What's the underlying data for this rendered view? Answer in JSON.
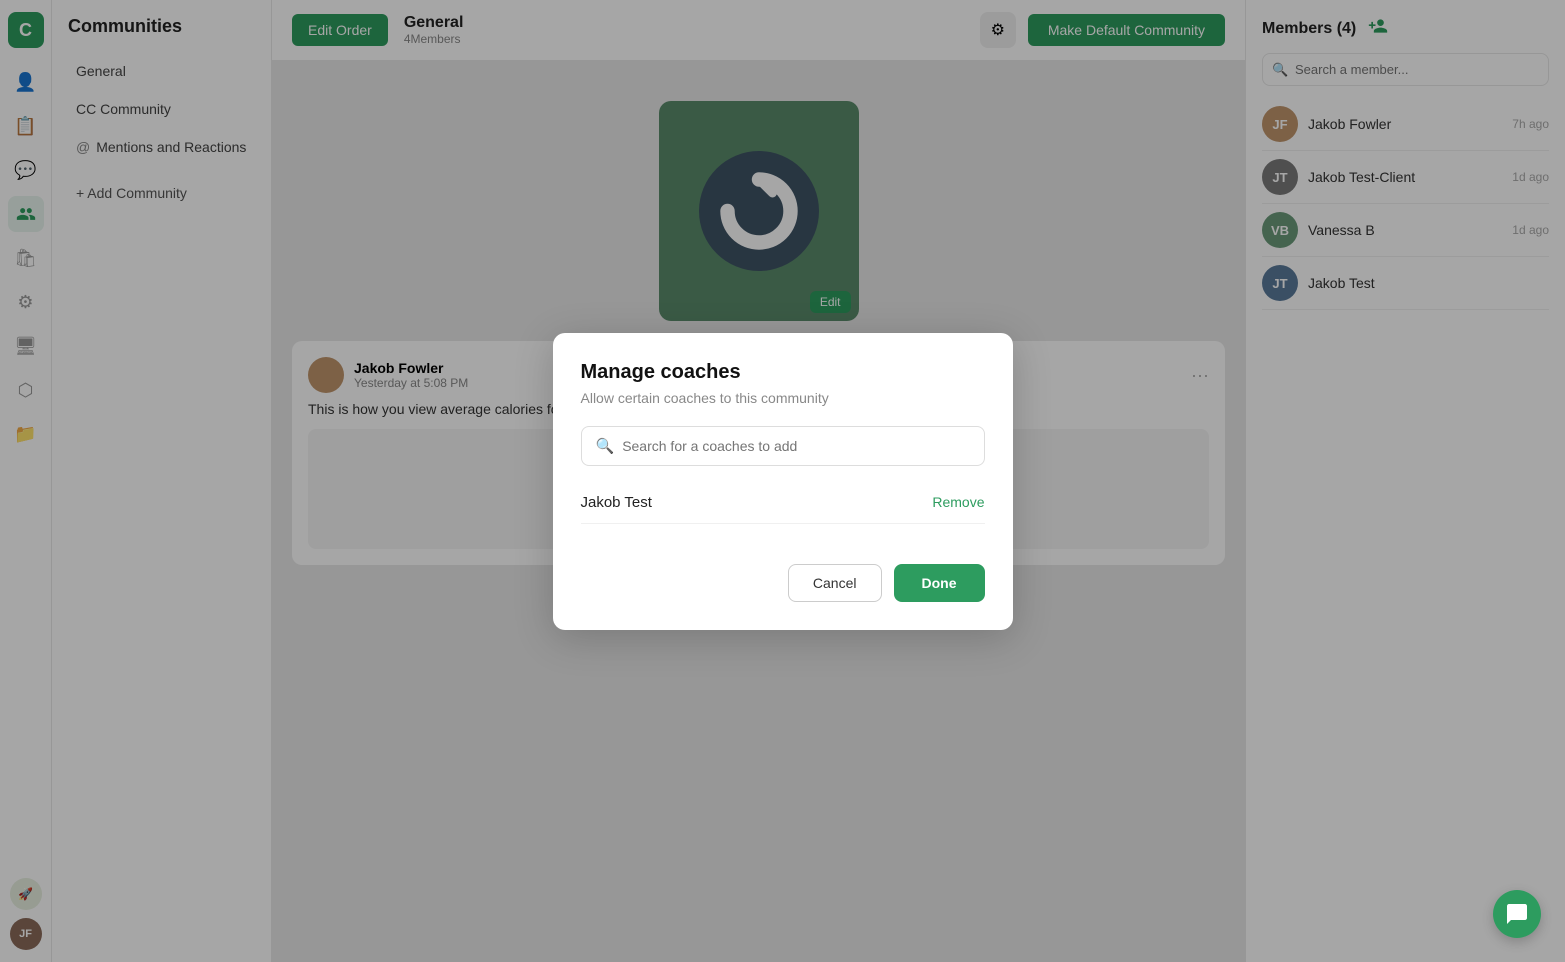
{
  "sidebar": {
    "logo_text": "C",
    "icons": [
      {
        "name": "users-icon",
        "symbol": "👤",
        "active": false
      },
      {
        "name": "document-icon",
        "symbol": "📄",
        "active": false
      },
      {
        "name": "chat-icon",
        "symbol": "💬",
        "active": false
      },
      {
        "name": "community-icon",
        "symbol": "👥",
        "active": true
      },
      {
        "name": "bag-icon",
        "symbol": "🛍",
        "active": false
      },
      {
        "name": "sliders-icon",
        "symbol": "⚙",
        "active": false
      },
      {
        "name": "monitor-icon",
        "symbol": "🖥",
        "active": false
      },
      {
        "name": "integrations-icon",
        "symbol": "⬡",
        "active": false
      },
      {
        "name": "folder-icon",
        "symbol": "📁",
        "active": false
      }
    ],
    "bottom_icons": [
      {
        "name": "rocket-icon",
        "symbol": "🚀"
      },
      {
        "name": "user-avatar",
        "symbol": "👤"
      }
    ]
  },
  "left_panel": {
    "title": "Communities",
    "nav_items": [
      {
        "label": "General",
        "id": "general"
      },
      {
        "label": "CC Community",
        "id": "cc-community"
      },
      {
        "label": "Mentions and Reactions",
        "id": "mentions",
        "prefix": "@"
      }
    ],
    "add_community_label": "+ Add Community"
  },
  "center": {
    "community_name": "General",
    "members_count": "4Members",
    "edit_order_label": "Edit Order",
    "gear_symbol": "⚙",
    "make_default_label": "Make Default Community",
    "edit_label": "Edit",
    "post": {
      "author": "Jakob Fowler",
      "time": "Yesterday at 5:08 PM",
      "text": "This is how you view average calories for the week"
    }
  },
  "right_panel": {
    "members_title": "Members (4)",
    "add_member_symbol": "👤+",
    "search_placeholder": "Search a member...",
    "members": [
      {
        "name": "Jakob Fowler",
        "time": "7h ago",
        "initials": "JF",
        "color": "#c0956c"
      },
      {
        "name": "Jakob Test-Client",
        "time": "1d ago",
        "initials": "JT",
        "color": "#8a8a8a"
      },
      {
        "name": "Vanessa B",
        "time": "1d ago",
        "initials": "VB",
        "color": "#7a9a8a"
      },
      {
        "name": "Jakob Test",
        "time": "",
        "initials": "JT",
        "color": "#5a7a9a"
      }
    ]
  },
  "modal": {
    "title": "Manage coaches",
    "subtitle": "Allow certain coaches to this community",
    "search_placeholder": "Search for a coaches to add",
    "search_icon": "🔍",
    "coaches": [
      {
        "name": "Jakob Test",
        "remove_label": "Remove"
      }
    ],
    "cancel_label": "Cancel",
    "done_label": "Done"
  },
  "chat_fab_symbol": "💬",
  "colors": {
    "primary": "#2d9c5f",
    "accent": "#2d9c5f"
  }
}
